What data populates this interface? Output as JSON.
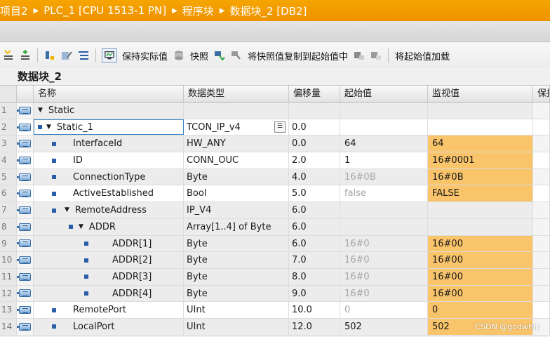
{
  "breadcrumb": [
    "项目2",
    "PLC_1 [CPU 1513-1 PN]",
    "程序块",
    "数据块_2 [DB2]"
  ],
  "toolbar": {
    "keep_actual": "保持实际值",
    "snapshot": "快照",
    "copy_snapshot": "将快照值复制到起始值中",
    "load_start": "将起始值加载"
  },
  "block_title": "数据块_2",
  "columns": [
    "名称",
    "数据类型",
    "偏移量",
    "起始值",
    "监视值",
    "保持"
  ],
  "rows": [
    {
      "num": "1",
      "name": "Static",
      "type": "",
      "offset": "",
      "start": "",
      "monitor": ""
    },
    {
      "num": "2",
      "name": "Static_1",
      "type": "TCON_IP_v4",
      "offset": "0.0",
      "start": "",
      "monitor": ""
    },
    {
      "num": "3",
      "name": "InterfaceId",
      "type": "HW_ANY",
      "offset": "0.0",
      "start": "64",
      "monitor": "64"
    },
    {
      "num": "4",
      "name": "ID",
      "type": "CONN_OUC",
      "offset": "2.0",
      "start": "1",
      "monitor": "16#0001"
    },
    {
      "num": "5",
      "name": "ConnectionType",
      "type": "Byte",
      "offset": "4.0",
      "start": "16#0B",
      "monitor": "16#0B"
    },
    {
      "num": "6",
      "name": "ActiveEstablished",
      "type": "Bool",
      "offset": "5.0",
      "start": "false",
      "monitor": "FALSE"
    },
    {
      "num": "7",
      "name": "RemoteAddress",
      "type": "IP_V4",
      "offset": "6.0",
      "start": "",
      "monitor": ""
    },
    {
      "num": "8",
      "name": "ADDR",
      "type": "Array[1..4] of Byte",
      "offset": "6.0",
      "start": "",
      "monitor": ""
    },
    {
      "num": "9",
      "name": "ADDR[1]",
      "type": "Byte",
      "offset": "6.0",
      "start": "16#0",
      "monitor": "16#00"
    },
    {
      "num": "10",
      "name": "ADDR[2]",
      "type": "Byte",
      "offset": "7.0",
      "start": "16#0",
      "monitor": "16#00"
    },
    {
      "num": "11",
      "name": "ADDR[3]",
      "type": "Byte",
      "offset": "8.0",
      "start": "16#0",
      "monitor": "16#00"
    },
    {
      "num": "12",
      "name": "ADDR[4]",
      "type": "Byte",
      "offset": "9.0",
      "start": "16#0",
      "monitor": "16#00"
    },
    {
      "num": "13",
      "name": "RemotePort",
      "type": "UInt",
      "offset": "10.0",
      "start": "0",
      "monitor": "0"
    },
    {
      "num": "14",
      "name": "LocalPort",
      "type": "UInt",
      "offset": "12.0",
      "start": "502",
      "monitor": "502"
    }
  ],
  "watermark": "CSDN @godwhip",
  "colors": {
    "titlebar": "#f29a00",
    "monitor_highlight": "#f9c46a",
    "db_icon": "#3a6ea5"
  }
}
